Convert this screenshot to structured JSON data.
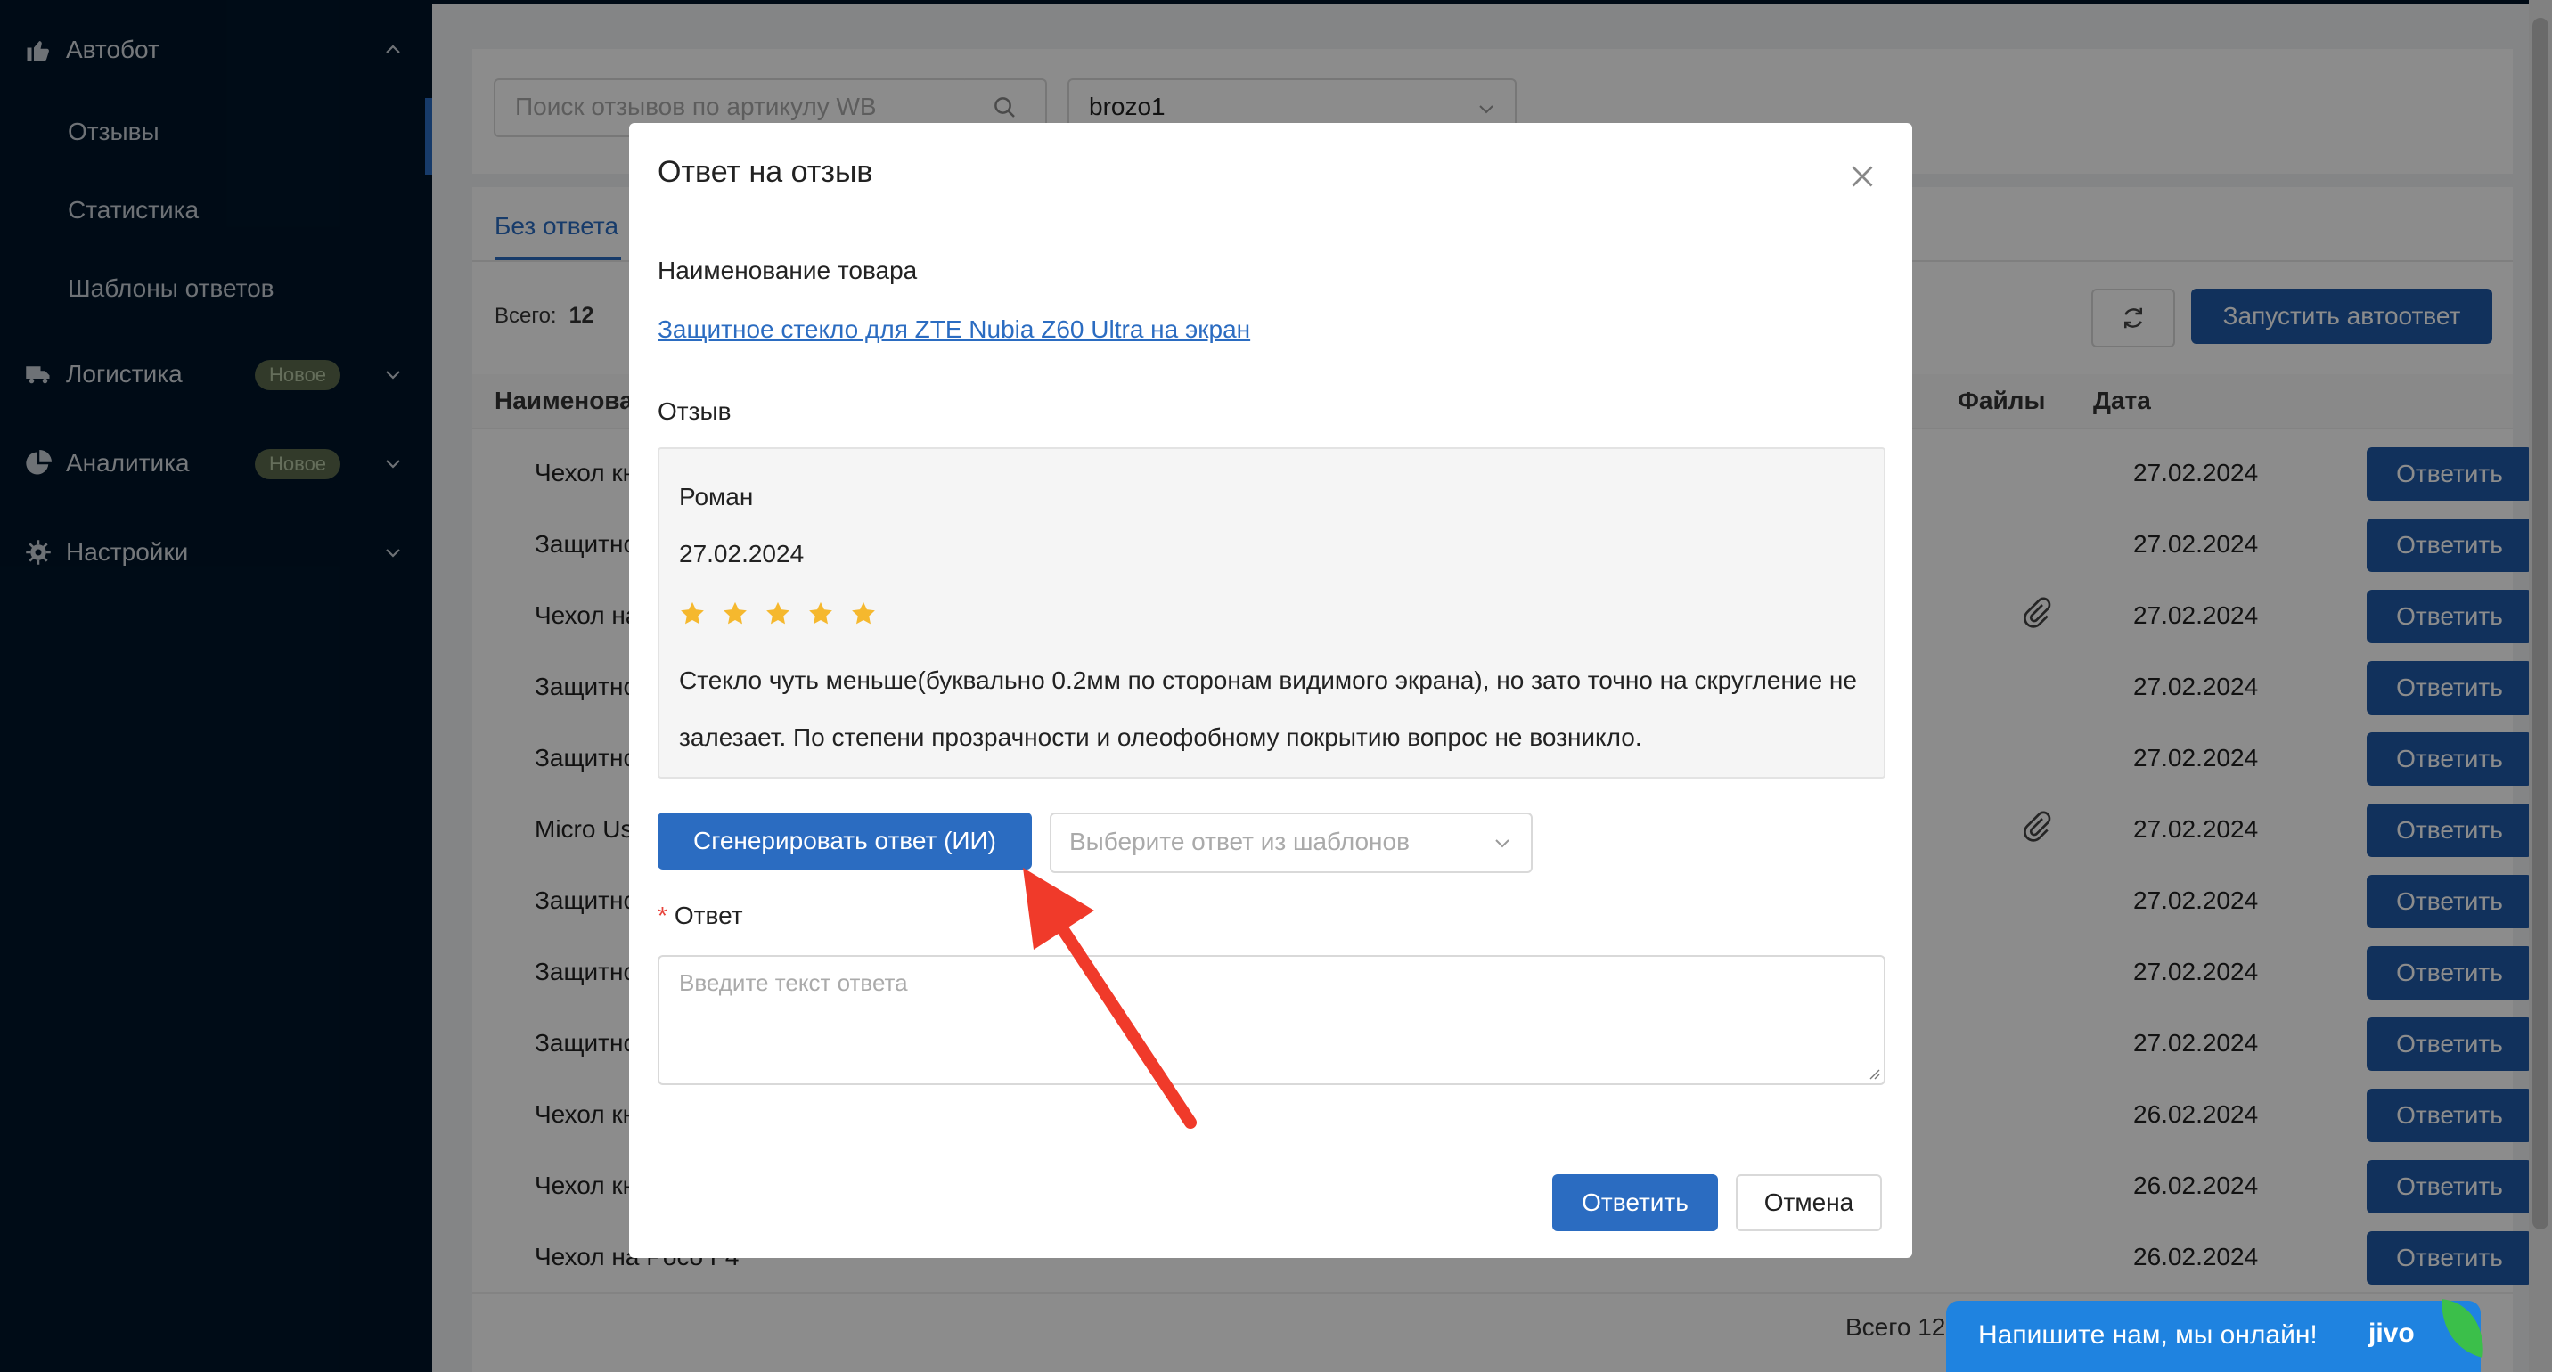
{
  "sidebar": {
    "groups": [
      {
        "label": "Автобот",
        "icon": "thumbs-up-icon"
      },
      {
        "label": "Логистика",
        "icon": "truck-icon",
        "badge": "Новое"
      },
      {
        "label": "Аналитика",
        "icon": "pie-chart-icon",
        "badge": "Новое"
      },
      {
        "label": "Настройки",
        "icon": "gear-icon"
      }
    ],
    "items": [
      {
        "label": "Отзывы"
      },
      {
        "label": "Статистика"
      },
      {
        "label": "Шаблоны ответов"
      }
    ]
  },
  "filters": {
    "search_placeholder": "Поиск отзывов по артикулу WB",
    "shop_value": "brozo1"
  },
  "tabs": {
    "active": "Без ответа"
  },
  "summary": {
    "total_label": "Всего:",
    "total_count": "12"
  },
  "toolbar": {
    "autostart_label": "Запустить автоответ"
  },
  "table": {
    "headers": {
      "name": "Наименова",
      "files": "Файлы",
      "date": "Дата"
    },
    "action_label": "Ответить",
    "rows": [
      {
        "name": "Чехол книж",
        "date": "27.02.2024",
        "has_file": false
      },
      {
        "name": "Защитное с",
        "date": "27.02.2024",
        "has_file": false
      },
      {
        "name": "Чехол на Те",
        "date": "27.02.2024",
        "has_file": true
      },
      {
        "name": "Защитное с",
        "date": "27.02.2024",
        "has_file": false
      },
      {
        "name": "Защитное с",
        "date": "27.02.2024",
        "has_file": false
      },
      {
        "name": "Micro Usb к",
        "date": "27.02.2024",
        "has_file": true
      },
      {
        "name": "Защитное с",
        "date": "27.02.2024",
        "has_file": false
      },
      {
        "name": "Защитное с",
        "date": "27.02.2024",
        "has_file": false
      },
      {
        "name": "Защитное с",
        "date": "27.02.2024",
        "has_file": false
      },
      {
        "name": "Чехол книж",
        "date": "26.02.2024",
        "has_file": false
      },
      {
        "name": "Чехол книж",
        "date": "26.02.2024",
        "has_file": false
      },
      {
        "name": "Чехол на Poco F4",
        "date": "26.02.2024",
        "has_file": false
      }
    ],
    "footer_total": "Всего 12"
  },
  "modal": {
    "title": "Ответ на отзыв",
    "product_label": "Наименование товара",
    "product_link": "Защитное стекло для ZTE Nubia Z60 Ultra на экран",
    "review_label": "Отзыв",
    "review": {
      "author": "Роман",
      "date": "27.02.2024",
      "rating": 5,
      "text": "Стекло чуть меньше(буквально 0.2мм по сторонам видимого экрана), но зато точно на скругление не залезает. По степени прозрачности и олеофобному покрытию вопрос не возникло."
    },
    "generate_label": "Сгенерировать ответ (ИИ)",
    "template_placeholder": "Выберите ответ из шаблонов",
    "answer_label": "Ответ",
    "answer_required_mark": "*",
    "answer_placeholder": "Введите текст ответа",
    "submit_label": "Ответить",
    "cancel_label": "Отмена"
  },
  "chat": {
    "text": "Напишите нам, мы онлайн!",
    "logo": "jivo"
  },
  "colors": {
    "sidebar_bg": "#001529",
    "primary": "#2b6cc1",
    "primary_dark": "#1f5aa8",
    "star": "#f5b82e",
    "arrow": "#f03a2a",
    "chat": "#1f83e0"
  }
}
